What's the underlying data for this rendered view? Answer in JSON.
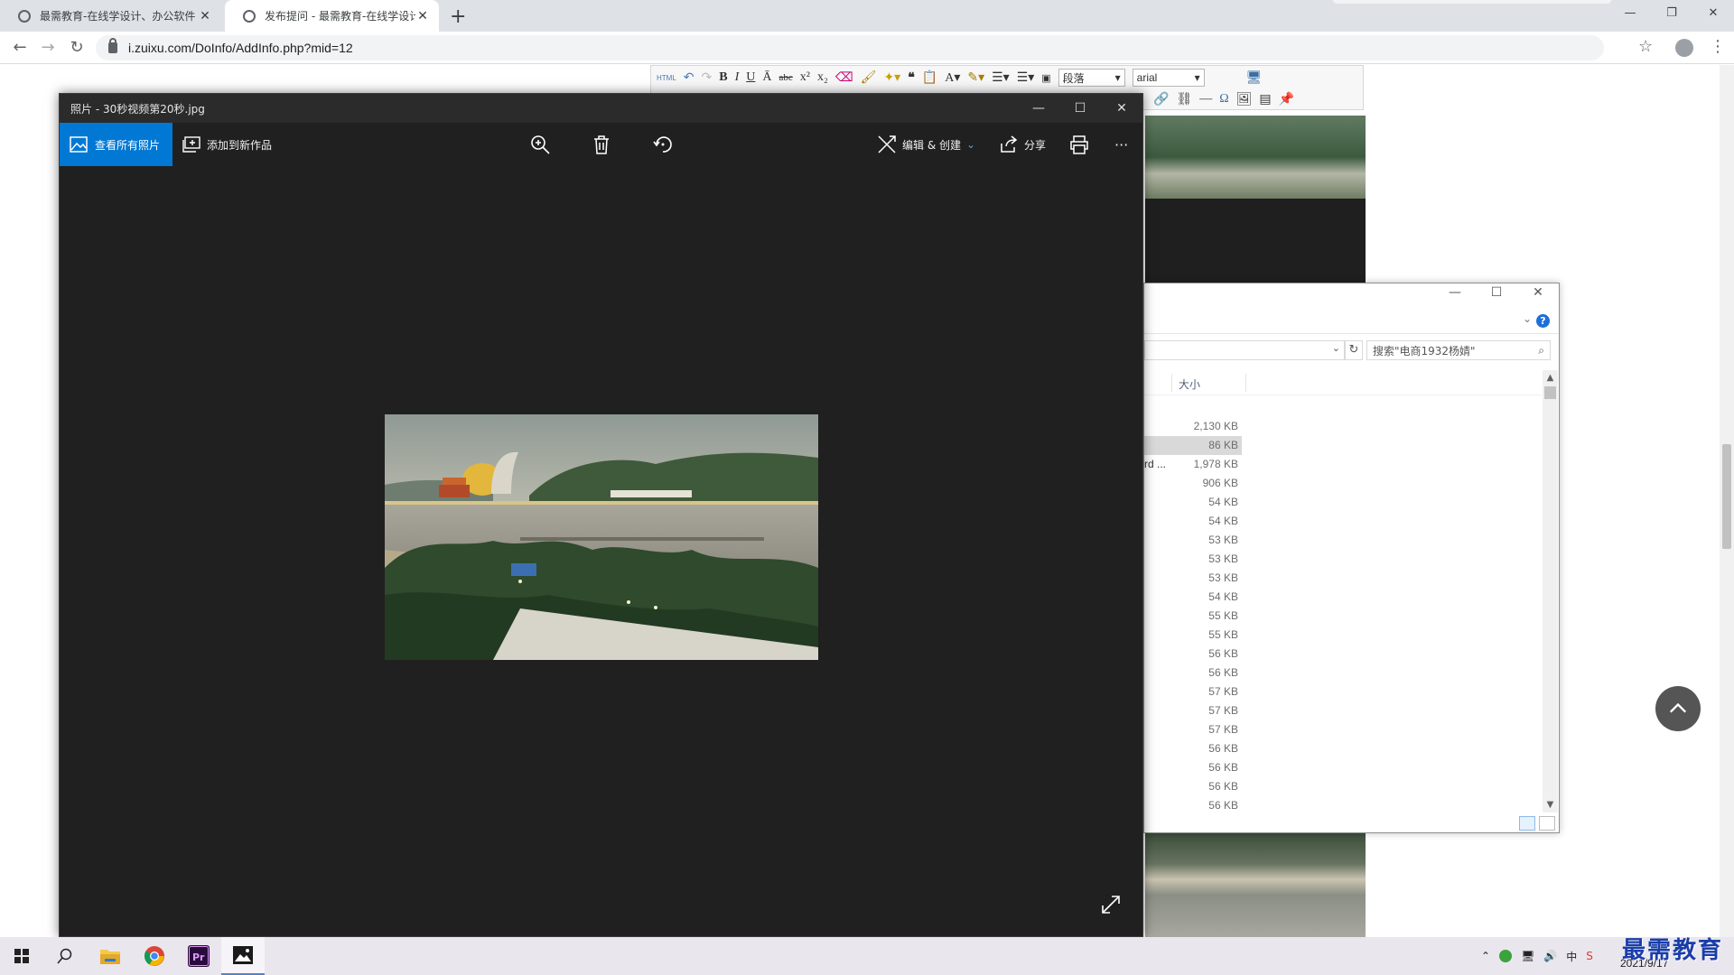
{
  "browser": {
    "tabs": [
      {
        "title": "最需教育-在线学设计、办公软件",
        "active": false
      },
      {
        "title": "发布提问 - 最需教育-在线学设计",
        "active": true
      }
    ],
    "new_tab": "+",
    "url": "i.zuixu.com/DoInfo/AddInfo.php?mid=12"
  },
  "editor": {
    "html_btn": "HTML",
    "paragraph_select": "段落",
    "font_select": "arial"
  },
  "photos": {
    "window_title": "照片 - 30秒视频第20秒.jpg",
    "view_all_label": "查看所有照片",
    "add_to_creation_label": "添加到新作品",
    "edit_create_label": "编辑 & 创建",
    "share_label": "分享",
    "more_label": "···"
  },
  "explorer": {
    "search_placeholder": "搜索\"电商1932杨婧\"",
    "size_header": "大小",
    "truncated_name": "rd ...",
    "sizes": [
      "2,130 KB",
      "86 KB",
      "1,978 KB",
      "906 KB",
      "54 KB",
      "54 KB",
      "53 KB",
      "53 KB",
      "53 KB",
      "54 KB",
      "55 KB",
      "55 KB",
      "56 KB",
      "56 KB",
      "57 KB",
      "57 KB",
      "57 KB",
      "56 KB",
      "56 KB",
      "56 KB",
      "56 KB"
    ],
    "selected_index": 1
  },
  "taskbar": {
    "date": "2021/9/17",
    "watermark": "最需教育"
  },
  "colors": {
    "accent": "#0078d4",
    "photos_bg": "#202020",
    "taskbar_bg": "#e9e6ed"
  }
}
